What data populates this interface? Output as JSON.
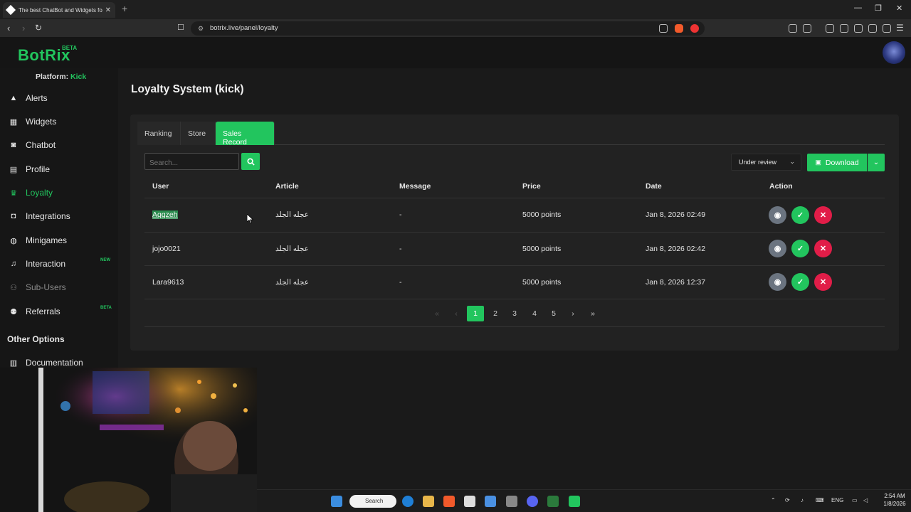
{
  "browser": {
    "tab_title": "The best ChatBot and Widgets fo",
    "url": "botrix.live/panel/loyalty",
    "window_controls": [
      "—",
      "❐",
      "✕"
    ]
  },
  "app": {
    "logo": "BotRix",
    "logo_badge": "BETA",
    "platform_label": "Platform:",
    "platform_value": "Kick"
  },
  "sidebar": {
    "items": [
      {
        "label": "Alerts",
        "icon": "alert-triangle-icon"
      },
      {
        "label": "Widgets",
        "icon": "grid-icon"
      },
      {
        "label": "Chatbot",
        "icon": "robot-icon"
      },
      {
        "label": "Profile",
        "icon": "id-card-icon"
      },
      {
        "label": "Loyalty",
        "icon": "trophy-icon"
      },
      {
        "label": "Integrations",
        "icon": "plug-icon"
      },
      {
        "label": "Minigames",
        "icon": "gamepad-icon"
      },
      {
        "label": "Interaction",
        "icon": "music-icon",
        "badge": "NEW"
      },
      {
        "label": "Sub-Users",
        "icon": "users-icon"
      },
      {
        "label": "Referrals",
        "icon": "user-group-icon",
        "badge": "BETA"
      }
    ],
    "other_options_title": "Other Options",
    "other_items": [
      {
        "label": "Documentation",
        "icon": "book-icon"
      }
    ]
  },
  "main": {
    "title": "Loyalty System (kick)",
    "tabs": [
      {
        "label": "Ranking"
      },
      {
        "label": "Store"
      },
      {
        "label": "Sales Record",
        "active": true
      }
    ],
    "search": {
      "placeholder": "Search..."
    },
    "filter": {
      "selected": "Under review"
    },
    "download_label": "Download",
    "table": {
      "headers": [
        "User",
        "Article",
        "Message",
        "Price",
        "Date",
        "Action"
      ],
      "rows": [
        {
          "user": "Aqqzeh",
          "article": "عجله الجلد",
          "message": "-",
          "price": "5000 points",
          "date": "Jan 8, 2026 02:49"
        },
        {
          "user": "jojo0021",
          "article": "عجله الجلد",
          "message": "-",
          "price": "5000 points",
          "date": "Jan 8, 2026 02:42"
        },
        {
          "user": "Lara9613",
          "article": "عجله الجلد",
          "message": "-",
          "price": "5000 points",
          "date": "Jan 8, 2026 12:37"
        }
      ]
    },
    "pagination": {
      "first": "«",
      "prev": "‹",
      "pages": [
        "1",
        "2",
        "3",
        "4",
        "5"
      ],
      "current": "1",
      "next": "›",
      "last": "»"
    }
  },
  "taskbar": {
    "search_label": "Search",
    "language": "ENG",
    "time": "2:54 AM",
    "date": "1/8/2026"
  },
  "colors": {
    "accent": "#22c55e",
    "danger": "#e11d48",
    "neutral_action": "#6b7480",
    "background": "#1a1a1a",
    "panel": "#222222"
  }
}
